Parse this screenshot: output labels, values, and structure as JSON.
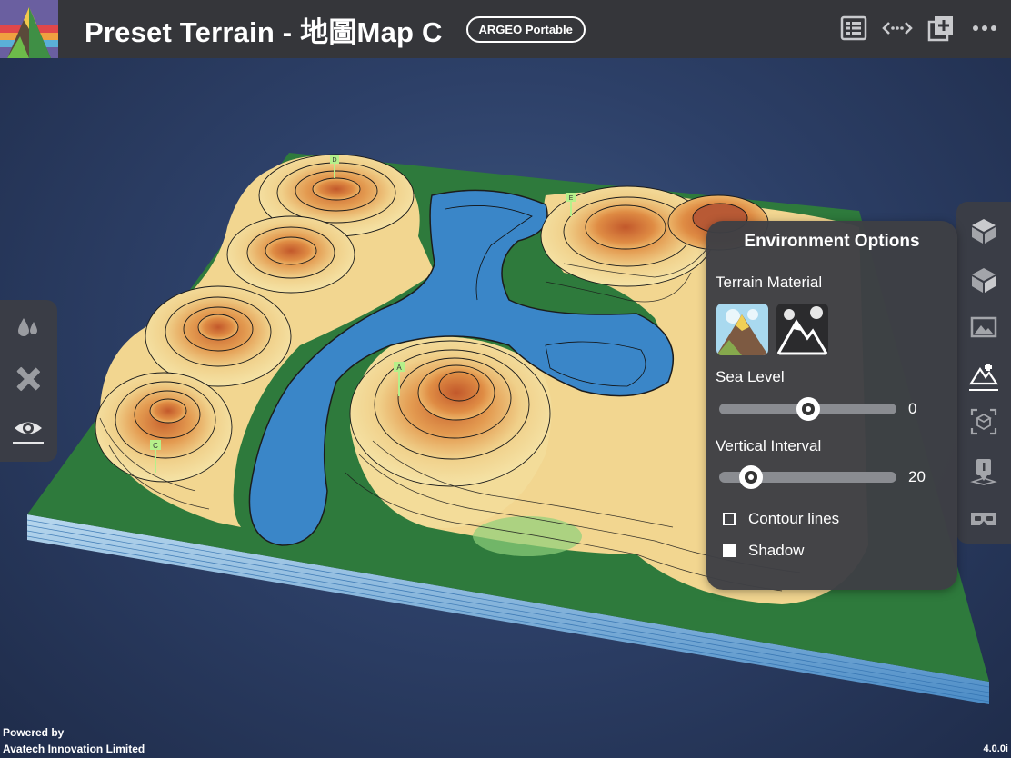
{
  "header": {
    "title": "Preset Terrain - 地圖Map C",
    "badge": "ARGEO Portable",
    "icons": [
      "list-icon",
      "swap-arrows-icon",
      "add-layer-icon",
      "more-icon"
    ]
  },
  "left_toolbar": {
    "items": [
      "water-drops-icon",
      "ruler-pencil-icon",
      "eye-icon"
    ],
    "active": "eye-icon"
  },
  "right_toolbar": {
    "items": [
      "box-top-icon",
      "box-side-icon",
      "image-icon",
      "terrain-edit-icon",
      "ar-frame-icon",
      "placemark-icon",
      "vr-goggles-icon"
    ],
    "active": "terrain-edit-icon"
  },
  "markers": [
    "D",
    "E",
    "A",
    "C"
  ],
  "env_panel": {
    "title": "Environment Options",
    "terrain_material_label": "Terrain Material",
    "materials": [
      "natural-terrain",
      "snow-mountain"
    ],
    "sea_level_label": "Sea Level",
    "sea_level_value": "0",
    "sea_level_fraction": 0.5,
    "vertical_interval_label": "Vertical Interval",
    "vertical_interval_value": "20",
    "vertical_interval_fraction": 0.18,
    "contour_label": "Contour lines",
    "contour_checked": false,
    "shadow_label": "Shadow",
    "shadow_checked": true
  },
  "footer": {
    "powered_by": "Powered by",
    "company": "Avatech Innovation Limited",
    "version": "4.0.0i"
  },
  "colors": {
    "topbar": "#35363a",
    "panel": "#3e3f44",
    "water": "#3a86c8",
    "land_base": "#2e7a3c",
    "marker": "#b6f08a"
  }
}
